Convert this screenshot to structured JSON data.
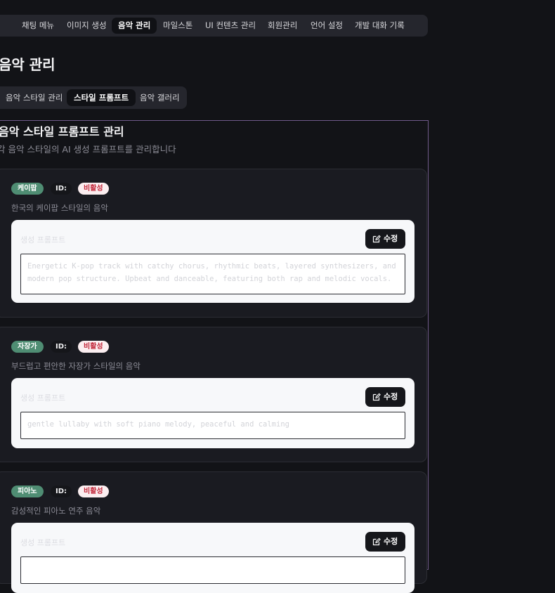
{
  "nav": {
    "items": [
      {
        "label": "채팅 메뉴",
        "active": false
      },
      {
        "label": "이미지 생성",
        "active": false
      },
      {
        "label": "음악 관리",
        "active": true
      },
      {
        "label": "마일스톤",
        "active": false
      },
      {
        "label": "UI 컨텐츠 관리",
        "active": false
      },
      {
        "label": "회원관리",
        "active": false
      },
      {
        "label": "언어 설정",
        "active": false
      },
      {
        "label": "개발 대화 기록",
        "active": false
      }
    ]
  },
  "page": {
    "title": "음악 관리"
  },
  "subtabs": [
    {
      "label": "음악 스타일 관리",
      "active": false
    },
    {
      "label": "스타일 프롬프트",
      "active": true
    },
    {
      "label": "음악 갤러리",
      "active": false
    }
  ],
  "panel": {
    "title": "음악 스타일 프롬프트 관리",
    "description": "각 음악 스타일의 AI 생성 프롬프트를 관리합니다"
  },
  "cards": [
    {
      "name": "케이팝",
      "id_label": "ID:",
      "status": "비활성",
      "description": "한국의 케이팝 스타일의 음악",
      "prompt_label": "생성 프롬프트",
      "edit_label": "수정",
      "prompt": "Energetic K-pop track with catchy chorus, rhythmic beats, layered synthesizers, and modern pop structure. Upbeat and danceable, featuring both rap and melodic vocals."
    },
    {
      "name": "자장가",
      "id_label": "ID:",
      "status": "비활성",
      "description": "부드럽고 편안한 자장가 스타일의 음악",
      "prompt_label": "생성 프롬프트",
      "edit_label": "수정",
      "prompt": "gentle lullaby with soft piano melody, peaceful and calming"
    },
    {
      "name": "피아노",
      "id_label": "ID:",
      "status": "비활성",
      "description": "감성적인 피아노 연주 음악",
      "prompt_label": "생성 프롬프트",
      "edit_label": "수정",
      "prompt": ""
    }
  ],
  "colors": {
    "background": "#121317",
    "accent_badge": "#4f8d73",
    "status_badge_text": "#c2273a",
    "panel_border": "#6f5a8a"
  }
}
